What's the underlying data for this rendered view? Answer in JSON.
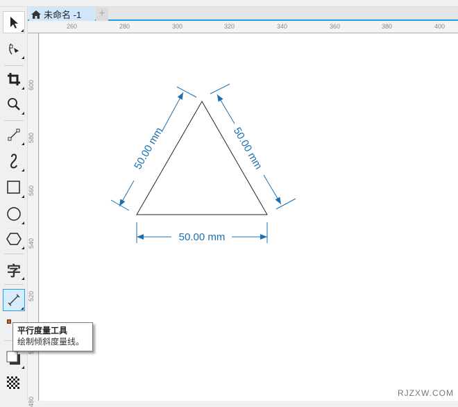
{
  "document": {
    "tab_title": "未命名 -1",
    "add_tab": "+"
  },
  "rulers": {
    "horizontal": [
      "260",
      "280",
      "300",
      "320",
      "340",
      "360",
      "380",
      "400"
    ],
    "vertical": [
      "600",
      "580",
      "560",
      "540",
      "520",
      "500",
      "480"
    ]
  },
  "tools": [
    "pick-tool",
    "shape-tool",
    "crop-tool",
    "zoom-tool",
    "line-tool",
    "freehand-tool",
    "rectangle-tool",
    "ellipse-tool",
    "polygon-tool",
    "text-tool",
    "parallel-dimension-tool",
    "interactive-fill-tool",
    "shadow-tool",
    "transparency-tool"
  ],
  "tooltip": {
    "title": "平行度量工具",
    "description": "绘制倾斜度量线。"
  },
  "dimensions": {
    "left": "50.00 mm",
    "right": "50.00 mm",
    "bottom": "50.00 mm"
  },
  "colors": {
    "dimension": "#1b6fb0",
    "accent": "#1aa3e8"
  },
  "watermark": "RJZXW.COM"
}
